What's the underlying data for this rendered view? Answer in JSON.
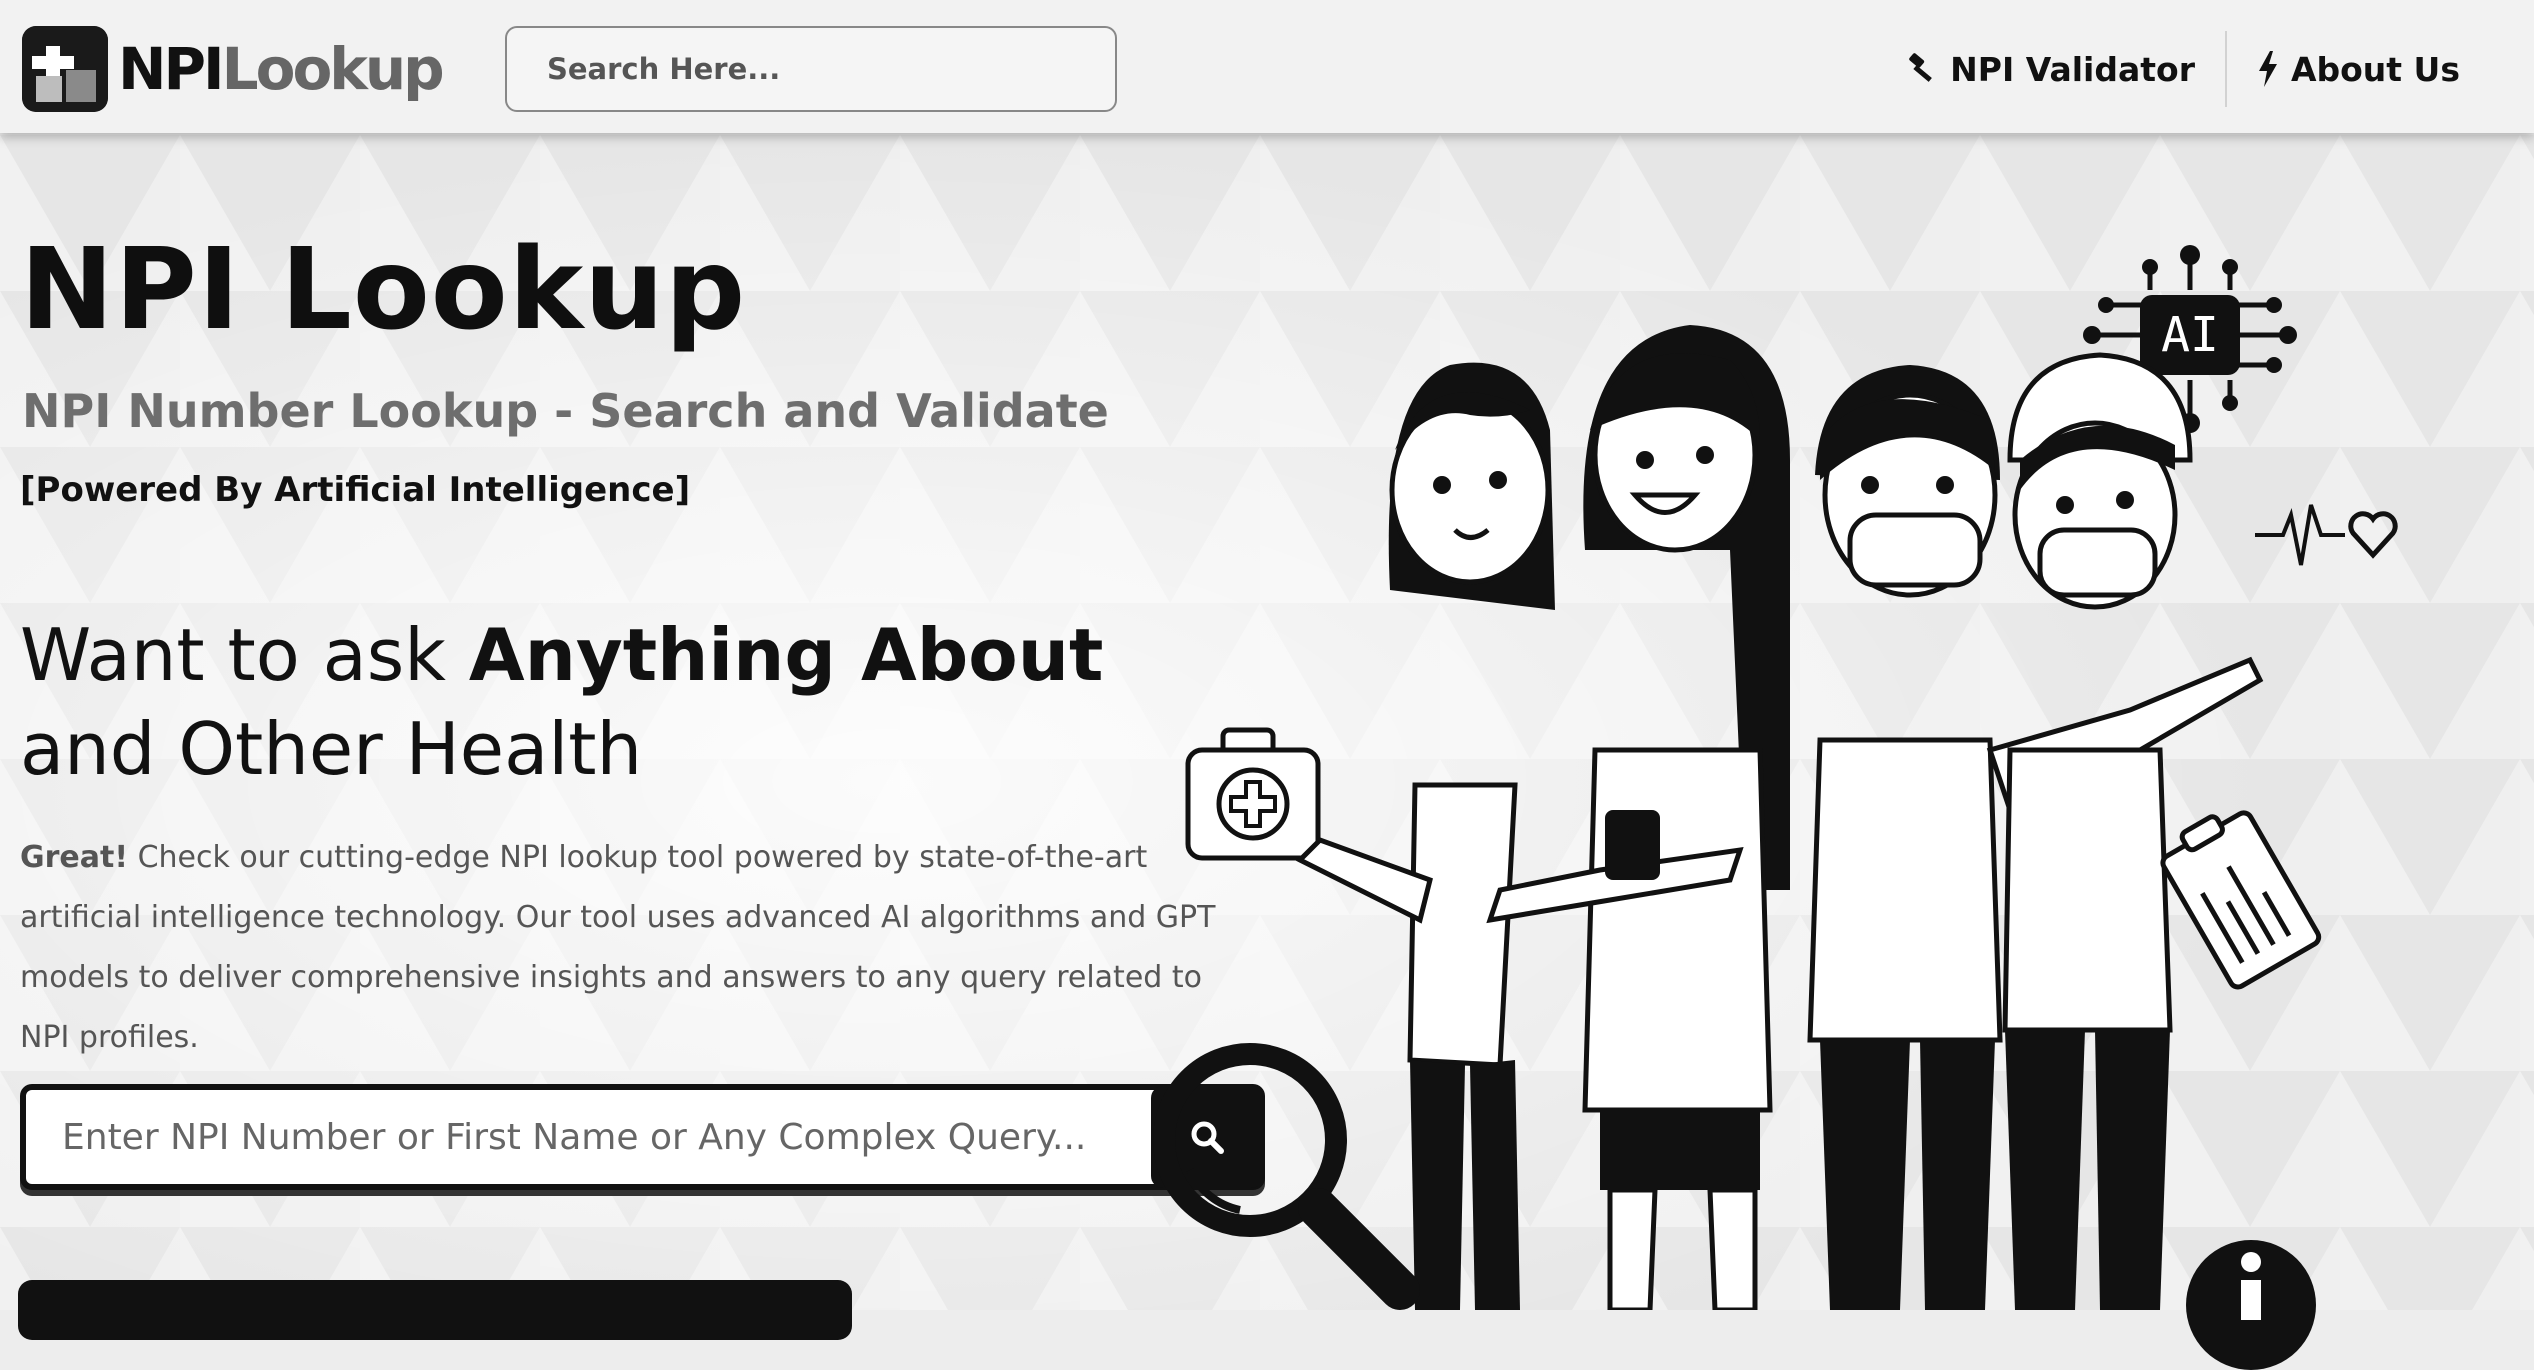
{
  "header": {
    "logo": {
      "part1": "NPI",
      "part2": "Lookup",
      "icon": "medical-cross-logo-icon"
    },
    "search_placeholder": "Search Here...",
    "nav": [
      {
        "label": "NPI Validator",
        "icon": "gavel-icon"
      },
      {
        "label": "About Us",
        "icon": "lightning-bolt-icon"
      }
    ]
  },
  "hero": {
    "title": "NPI Lookup",
    "subtitle": "NPI Number Lookup - Search and Validate",
    "powered": "[Powered By Artificial Intelligence]",
    "ask_line1_normal": "Want to ask ",
    "ask_line1_bold": "Anything About",
    "ask_line2": "and Other Health",
    "desc_bold": "Great!",
    "desc_text": " Check our cutting-edge NPI lookup tool powered by state-of-the-art artificial intelligence technology. Our tool uses advanced AI algorithms and GPT models to deliver comprehensive insights and answers to any query related to NPI profiles.",
    "search_placeholder": "Enter NPI Number or First Name or Any Complex Query...",
    "search_icon": "search-icon"
  },
  "illustration": {
    "ai_chip_label": "AI",
    "icons": [
      "ai-chip-icon",
      "heartbeat-heart-icon",
      "first-aid-kit-icon",
      "clipboard-icon",
      "magnifier-icon",
      "info-icon"
    ]
  },
  "colors": {
    "page_bg": "#ededed",
    "header_bg": "#f2f2f2",
    "dark": "#111111",
    "muted": "#6e6e6e"
  }
}
